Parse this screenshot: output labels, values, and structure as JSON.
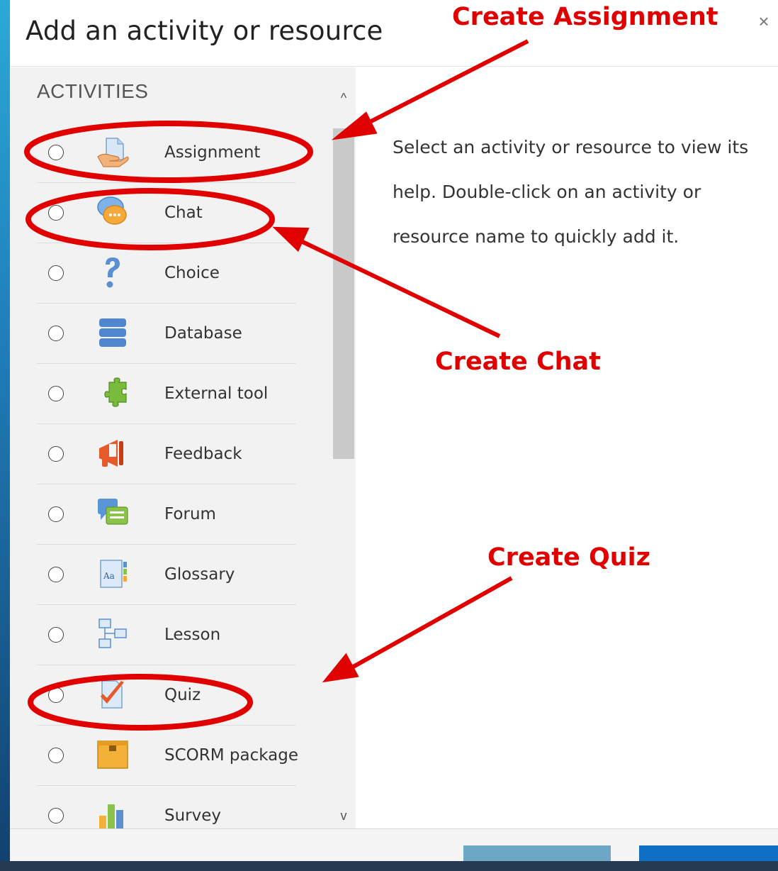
{
  "dialog": {
    "title": "Add an activity or resource",
    "close_glyph": "×"
  },
  "sidebar": {
    "section_heading": "ACTIVITIES",
    "items": [
      {
        "label": "Assignment",
        "icon": "assignment-icon"
      },
      {
        "label": "Chat",
        "icon": "chat-icon"
      },
      {
        "label": "Choice",
        "icon": "choice-icon"
      },
      {
        "label": "Database",
        "icon": "database-icon"
      },
      {
        "label": "External tool",
        "icon": "external-tool-icon"
      },
      {
        "label": "Feedback",
        "icon": "feedback-icon"
      },
      {
        "label": "Forum",
        "icon": "forum-icon"
      },
      {
        "label": "Glossary",
        "icon": "glossary-icon"
      },
      {
        "label": "Lesson",
        "icon": "lesson-icon"
      },
      {
        "label": "Quiz",
        "icon": "quiz-icon"
      },
      {
        "label": "SCORM package",
        "icon": "scorm-package-icon"
      },
      {
        "label": "Survey",
        "icon": "survey-icon"
      }
    ],
    "scroll_up_glyph": "^",
    "scroll_down_glyph": "v"
  },
  "help": {
    "text": "Select an activity or resource to view its help. Double-click on an activity or resource name to quickly add it."
  },
  "annotations": {
    "assignment": "Create Assignment",
    "chat": "Create Chat",
    "quiz": "Create Quiz",
    "color": "#e00000"
  }
}
